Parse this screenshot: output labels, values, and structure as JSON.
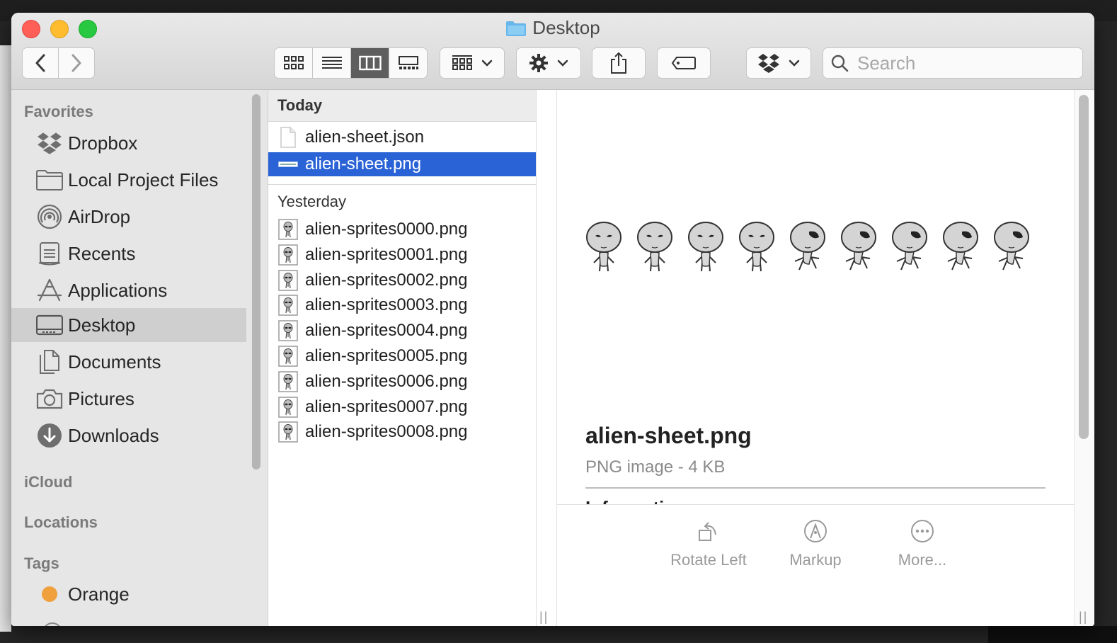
{
  "window": {
    "title": "Desktop"
  },
  "search": {
    "placeholder": "Search"
  },
  "sidebar": {
    "sections": {
      "favorites": "Favorites",
      "icloud": "iCloud",
      "locations": "Locations",
      "tags": "Tags"
    },
    "items": [
      {
        "label": "Dropbox",
        "icon": "dropbox-icon"
      },
      {
        "label": "Local Project Files",
        "icon": "folder-icon"
      },
      {
        "label": "AirDrop",
        "icon": "airdrop-icon"
      },
      {
        "label": "Recents",
        "icon": "recents-icon"
      },
      {
        "label": "Applications",
        "icon": "applications-icon"
      },
      {
        "label": "Desktop",
        "icon": "desktop-icon",
        "selected": true
      },
      {
        "label": "Documents",
        "icon": "documents-icon"
      },
      {
        "label": "Pictures",
        "icon": "camera-icon"
      },
      {
        "label": "Downloads",
        "icon": "downloads-icon"
      }
    ],
    "tags": [
      {
        "label": "Orange",
        "color": "#f0a03c"
      }
    ]
  },
  "files": {
    "today_label": "Today",
    "today": [
      {
        "name": "alien-sheet.json",
        "icon": "document-icon"
      },
      {
        "name": "alien-sheet.png",
        "icon": "image-icon",
        "selected": true
      }
    ],
    "yesterday_label": "Yesterday",
    "yesterday": [
      {
        "name": "alien-sprites0000.png"
      },
      {
        "name": "alien-sprites0001.png"
      },
      {
        "name": "alien-sprites0002.png"
      },
      {
        "name": "alien-sprites0003.png"
      },
      {
        "name": "alien-sprites0004.png"
      },
      {
        "name": "alien-sprites0005.png"
      },
      {
        "name": "alien-sprites0006.png"
      },
      {
        "name": "alien-sprites0007.png"
      },
      {
        "name": "alien-sprites0008.png"
      }
    ]
  },
  "preview": {
    "filename": "alien-sheet.png",
    "kind": "PNG image - 4 KB",
    "info_heading": "Information",
    "actions": [
      {
        "label": "Rotate Left",
        "icon": "rotate-left-icon"
      },
      {
        "label": "Markup",
        "icon": "markup-icon"
      },
      {
        "label": "More...",
        "icon": "more-icon"
      }
    ]
  },
  "colors": {
    "selection": "#2a63d6",
    "tag_orange": "#f0a03c"
  }
}
